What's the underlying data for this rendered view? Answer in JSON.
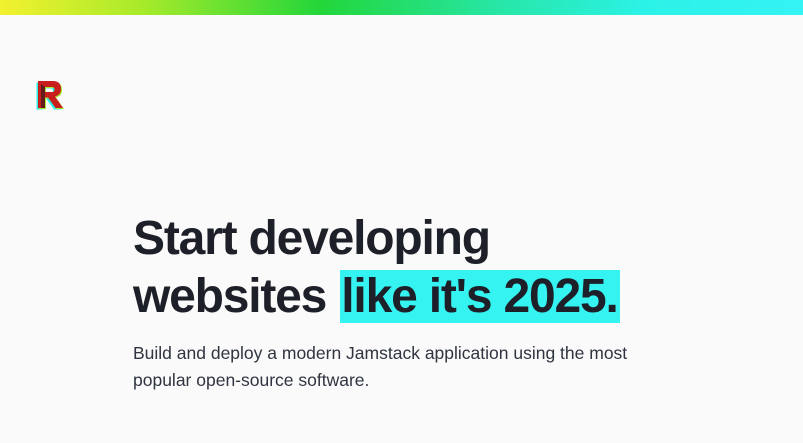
{
  "hero": {
    "headline_line1": "Start developing",
    "headline_line2_prefix": "websites",
    "headline_highlight": "like it's 2025.",
    "subtitle": "Build and deploy a modern Jamstack application using the most popular open-source software."
  },
  "colors": {
    "highlight": "#34f3f0",
    "text": "#1e2029",
    "background": "#fafafa",
    "logo_red": "#c81e1e"
  },
  "icons": {
    "logo": "r-logo-icon"
  }
}
